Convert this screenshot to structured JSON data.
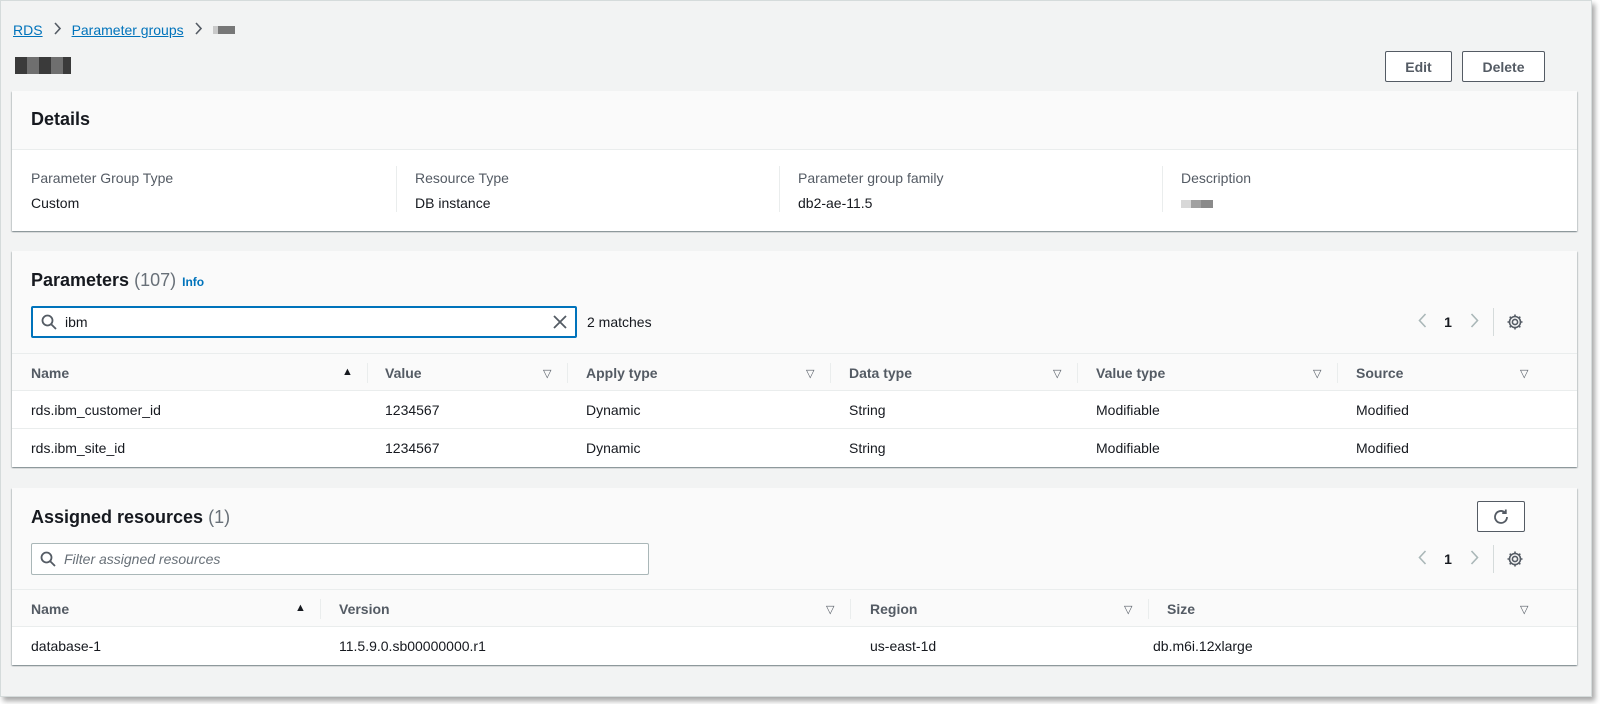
{
  "breadcrumb": {
    "rds": "RDS",
    "parameter_groups": "Parameter groups"
  },
  "header": {
    "edit_label": "Edit",
    "delete_label": "Delete"
  },
  "details": {
    "title": "Details",
    "fields": [
      {
        "label": "Parameter Group Type",
        "value": "Custom"
      },
      {
        "label": "Resource Type",
        "value": "DB instance"
      },
      {
        "label": "Parameter group family",
        "value": "db2-ae-11.5"
      },
      {
        "label": "Description",
        "value": ""
      }
    ]
  },
  "parameters": {
    "title": "Parameters",
    "count": "(107)",
    "info": "Info",
    "search_value": "ibm",
    "matches": "2 matches",
    "page": "1",
    "columns": [
      "Name",
      "Value",
      "Apply type",
      "Data type",
      "Value type",
      "Source"
    ],
    "rows": [
      [
        "rds.ibm_customer_id",
        "1234567",
        "Dynamic",
        "String",
        "Modifiable",
        "Modified"
      ],
      [
        "rds.ibm_site_id",
        "1234567",
        "Dynamic",
        "String",
        "Modifiable",
        "Modified"
      ]
    ]
  },
  "assigned": {
    "title": "Assigned resources",
    "count": "(1)",
    "search_placeholder": "Filter assigned resources",
    "page": "1",
    "columns": [
      "Name",
      "Version",
      "Region",
      "Size"
    ],
    "rows": [
      [
        "database-1",
        "11.5.9.0.sb00000000.r1",
        "us-east-1d",
        "db.m6i.12xlarge"
      ]
    ]
  },
  "colors": {
    "link": "#0073bb",
    "focus": "#0073bb",
    "background": "#f2f3f3"
  },
  "icons": [
    "chevron-right-icon",
    "search-icon",
    "clear-icon",
    "chevron-left-icon",
    "gear-icon",
    "refresh-icon",
    "sort-ascending-icon",
    "sort-descending-icon"
  ]
}
